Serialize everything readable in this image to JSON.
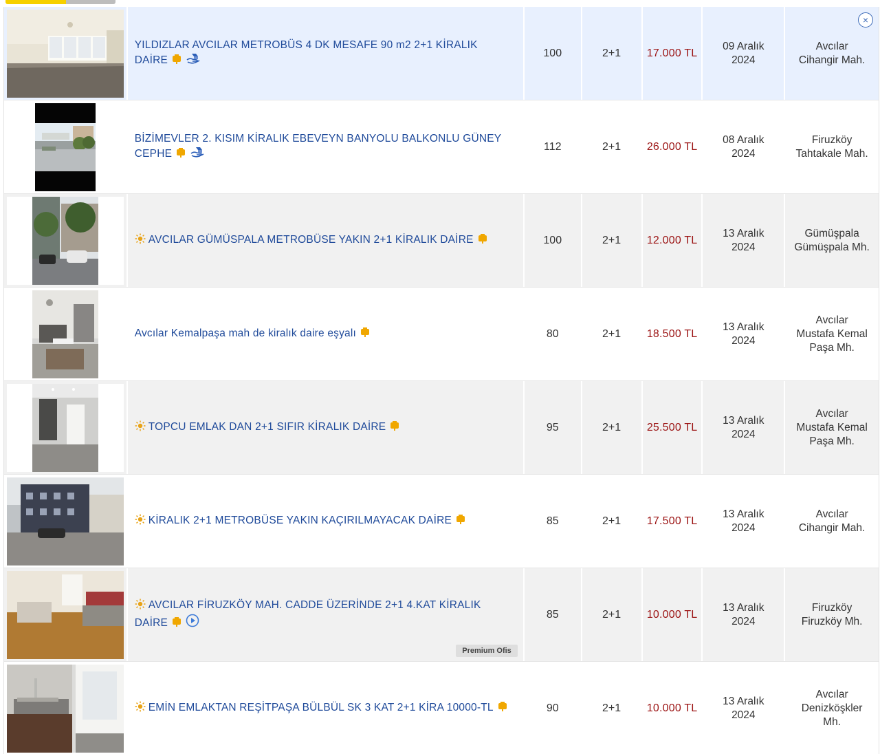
{
  "listings": [
    {
      "title": "YILDIZLAR AVCILAR METROBÜS 4 DK MESAFE 90 m2 2+1 KİRALIK DAİRE",
      "featured": false,
      "icons": [
        "shop-icon",
        "hand-house-icon"
      ],
      "m2": "100",
      "rooms": "2+1",
      "price": "17.000 TL",
      "date_day": "09 Aralık",
      "date_year": "2024",
      "loc1": "Avcılar",
      "loc2": "Cihangir Mah.",
      "loc3": ""
    },
    {
      "title": "BİZİMEVLER 2. KISIM KİRALIK EBEVEYN BANYOLU BALKONLU GÜNEY CEPHE",
      "featured": false,
      "icons": [
        "shop-icon",
        "hand-house-icon"
      ],
      "m2": "112",
      "rooms": "2+1",
      "price": "26.000 TL",
      "date_day": "08 Aralık",
      "date_year": "2024",
      "loc1": "Firuzköy",
      "loc2": "Tahtakale Mah.",
      "loc3": ""
    },
    {
      "title": "AVCILAR GÜMÜSPALA METROBÜSE YAKIN 2+1 KİRALIK DAİRE",
      "featured": true,
      "icons": [
        "shop-icon"
      ],
      "m2": "100",
      "rooms": "2+1",
      "price": "12.000 TL",
      "date_day": "13 Aralık",
      "date_year": "2024",
      "loc1": "Gümüşpala",
      "loc2": "Gümüşpala Mh.",
      "loc3": ""
    },
    {
      "title": "Avcılar Kemalpaşa mah de kiralık daire eşyalı",
      "featured": false,
      "icons": [
        "shop-icon"
      ],
      "m2": "80",
      "rooms": "2+1",
      "price": "18.500 TL",
      "date_day": "13 Aralık",
      "date_year": "2024",
      "loc1": "Avcılar",
      "loc2": "Mustafa Kemal",
      "loc3": "Paşa Mh."
    },
    {
      "title": "TOPCU EMLAK DAN 2+1 SIFIR KİRALIK DAİRE",
      "featured": true,
      "icons": [
        "shop-icon"
      ],
      "m2": "95",
      "rooms": "2+1",
      "price": "25.500 TL",
      "date_day": "13 Aralık",
      "date_year": "2024",
      "loc1": "Avcılar",
      "loc2": "Mustafa Kemal",
      "loc3": "Paşa Mh."
    },
    {
      "title": "KİRALIK 2+1 METROBÜSE YAKIN KAÇIRILMAYACAK DAİRE",
      "featured": true,
      "icons": [
        "shop-icon"
      ],
      "m2": "85",
      "rooms": "2+1",
      "price": "17.500 TL",
      "date_day": "13 Aralık",
      "date_year": "2024",
      "loc1": "Avcılar",
      "loc2": "Cihangir Mah.",
      "loc3": ""
    },
    {
      "title": "AVCILAR FİRUZKÖY MAH. CADDE ÜZERİNDE 2+1 4.KAT KİRALIK DAİRE",
      "featured": true,
      "icons": [
        "shop-icon",
        "play-video-icon"
      ],
      "m2": "85",
      "rooms": "2+1",
      "price": "10.000 TL",
      "date_day": "13 Aralık",
      "date_year": "2024",
      "loc1": "Firuzköy",
      "loc2": "Firuzköy Mh.",
      "loc3": "",
      "badge": "Premium Ofis"
    },
    {
      "title": "EMİN EMLAKTAN REŞİTPAŞA BÜLBÜL SK 3 KAT 2+1 KİRA 10000-TL",
      "featured": true,
      "icons": [
        "shop-icon"
      ],
      "m2": "90",
      "rooms": "2+1",
      "price": "10.000 TL",
      "date_day": "13 Aralık",
      "date_year": "2024",
      "loc1": "Avcılar",
      "loc2": "Denizköşkler",
      "loc3": "Mh."
    }
  ],
  "close_label": "×",
  "colors": {
    "title": "#1f4a9a",
    "price": "#9b1212",
    "highlight_row": "#e8f0fe",
    "gray_row": "#f1f1f1",
    "featured_sun": "#e8a317"
  }
}
